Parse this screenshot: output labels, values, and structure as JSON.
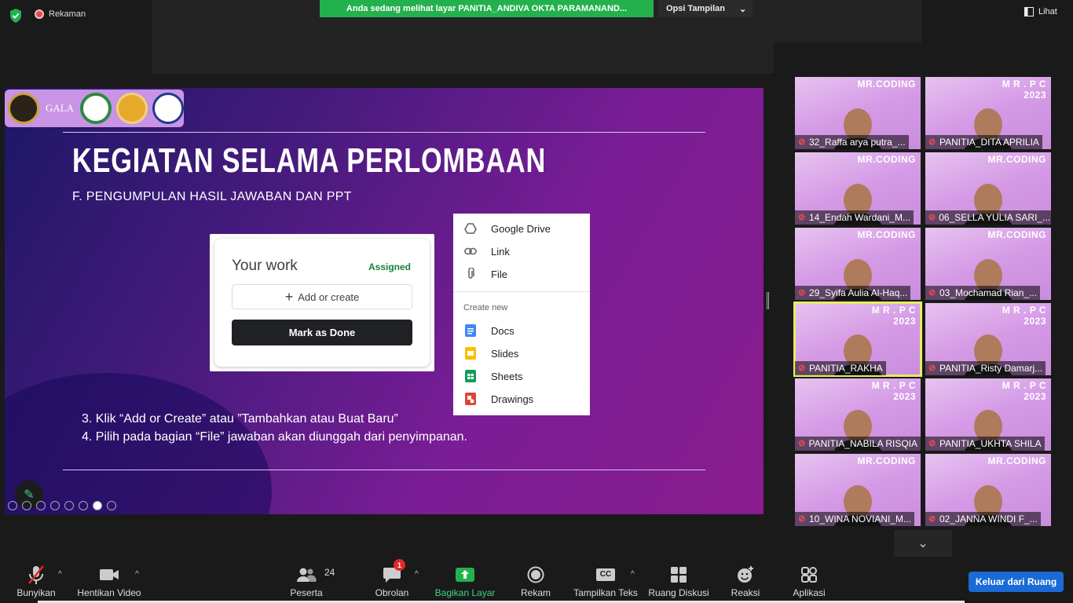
{
  "topbar": {
    "recording_label": "Rekaman",
    "share_banner": "Anda sedang melihat layar PANITIA_ANDIVA OKTA PARAMANAND...",
    "view_options_label": "Opsi Tampilan",
    "view_button_label": "Lihat"
  },
  "slide": {
    "title": "KEGIATAN SELAMA PERLOMBAAN",
    "subtitle": "F. PENGUMPULAN HASIL JAWABAN DAN PPT",
    "logos": [
      "GALA"
    ],
    "your_work": {
      "title": "Your work",
      "status": "Assigned",
      "add_label": "Add or create",
      "done_label": "Mark as Done"
    },
    "menu": {
      "top_items": [
        "Google Drive",
        "Link",
        "File"
      ],
      "section_title": "Create new",
      "create_items": [
        "Docs",
        "Slides",
        "Sheets",
        "Drawings"
      ]
    },
    "steps": [
      "3. Klik “Add or Create” atau ”Tambahkan atau Buat Baru”",
      "4. Pilih pada bagian “File”  jawaban akan diunggah dari penyimpanan."
    ]
  },
  "gallery": {
    "tiles": [
      {
        "name": "32_Raffa arya putra_...",
        "tag": "MR.CODING"
      },
      {
        "name": "PANITIA_DITA APRILIA",
        "tag": "M R . P C\n2023"
      },
      {
        "name": "14_Endah Wardani_M...",
        "tag": "MR.CODING"
      },
      {
        "name": "06_SELLA YULIA SARI_...",
        "tag": "MR.CODING"
      },
      {
        "name": "29_Syifa Aulia Al-Haq...",
        "tag": "MR.CODING"
      },
      {
        "name": "03_Mochamad Rian_...",
        "tag": "MR.CODING"
      },
      {
        "name": "PANITIA_RAKHA",
        "tag": "M R . P C\n2023"
      },
      {
        "name": "PANITIA_Risty Damarj...",
        "tag": "M R . P C\n2023"
      },
      {
        "name": "PANITIA_NABILA RISQIA",
        "tag": "M R . P C\n2023"
      },
      {
        "name": "PANITIA_UKHTA SHILA",
        "tag": "M R . P C\n2023"
      },
      {
        "name": "10_WINA NOVIANI_M...",
        "tag": "MR.CODING"
      },
      {
        "name": "02_JANNA WINDI F_...",
        "tag": "MR.CODING"
      }
    ]
  },
  "toolbar": {
    "mute": "Bunyikan",
    "video": "Hentikan Video",
    "participants": "Peserta",
    "participants_count": "24",
    "chat": "Obrolan",
    "chat_badge": "1",
    "share": "Bagikan Layar",
    "record": "Rekam",
    "captions": "Tampilkan Teks",
    "captions_icon": "CC",
    "breakout": "Ruang Diskusi",
    "reactions": "Reaksi",
    "apps": "Aplikasi",
    "leave": "Keluar dari Ruang"
  },
  "colors": {
    "share_green": "#23b14d",
    "leave_blue": "#1a6bd6",
    "active_speaker": "#e8ec62"
  }
}
